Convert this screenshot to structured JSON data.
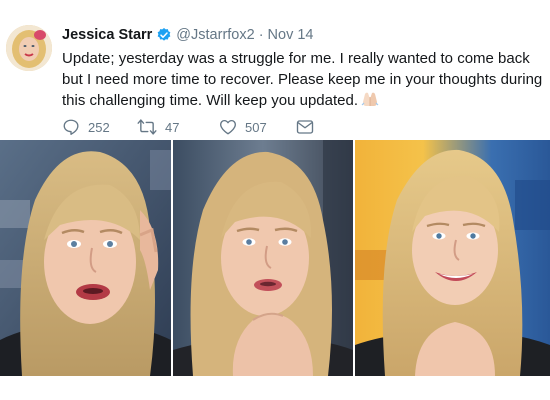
{
  "tweet": {
    "author_name": "Jessica Starr",
    "handle": "@Jstarrfox2",
    "separator": "·",
    "date": "Nov 14",
    "text": "Update; yesterday was a struggle for me. I really wanted to come back but I need more time to recover. Please keep me in your thoughts during this challenging time. Will keep you updated.",
    "emoji": "folded-hands"
  },
  "actions": {
    "reply_count": "252",
    "retweet_count": "47",
    "like_count": "507"
  },
  "icons": {
    "reply": "reply-icon",
    "retweet": "retweet-icon",
    "like": "heart-icon",
    "message": "envelope-icon",
    "verified": "verified-badge-icon"
  },
  "colors": {
    "verified_blue": "#1da1f2",
    "text": "#14171a",
    "secondary": "#657786"
  },
  "photos": [
    {
      "name": "photo-left"
    },
    {
      "name": "photo-middle"
    },
    {
      "name": "photo-right"
    }
  ]
}
